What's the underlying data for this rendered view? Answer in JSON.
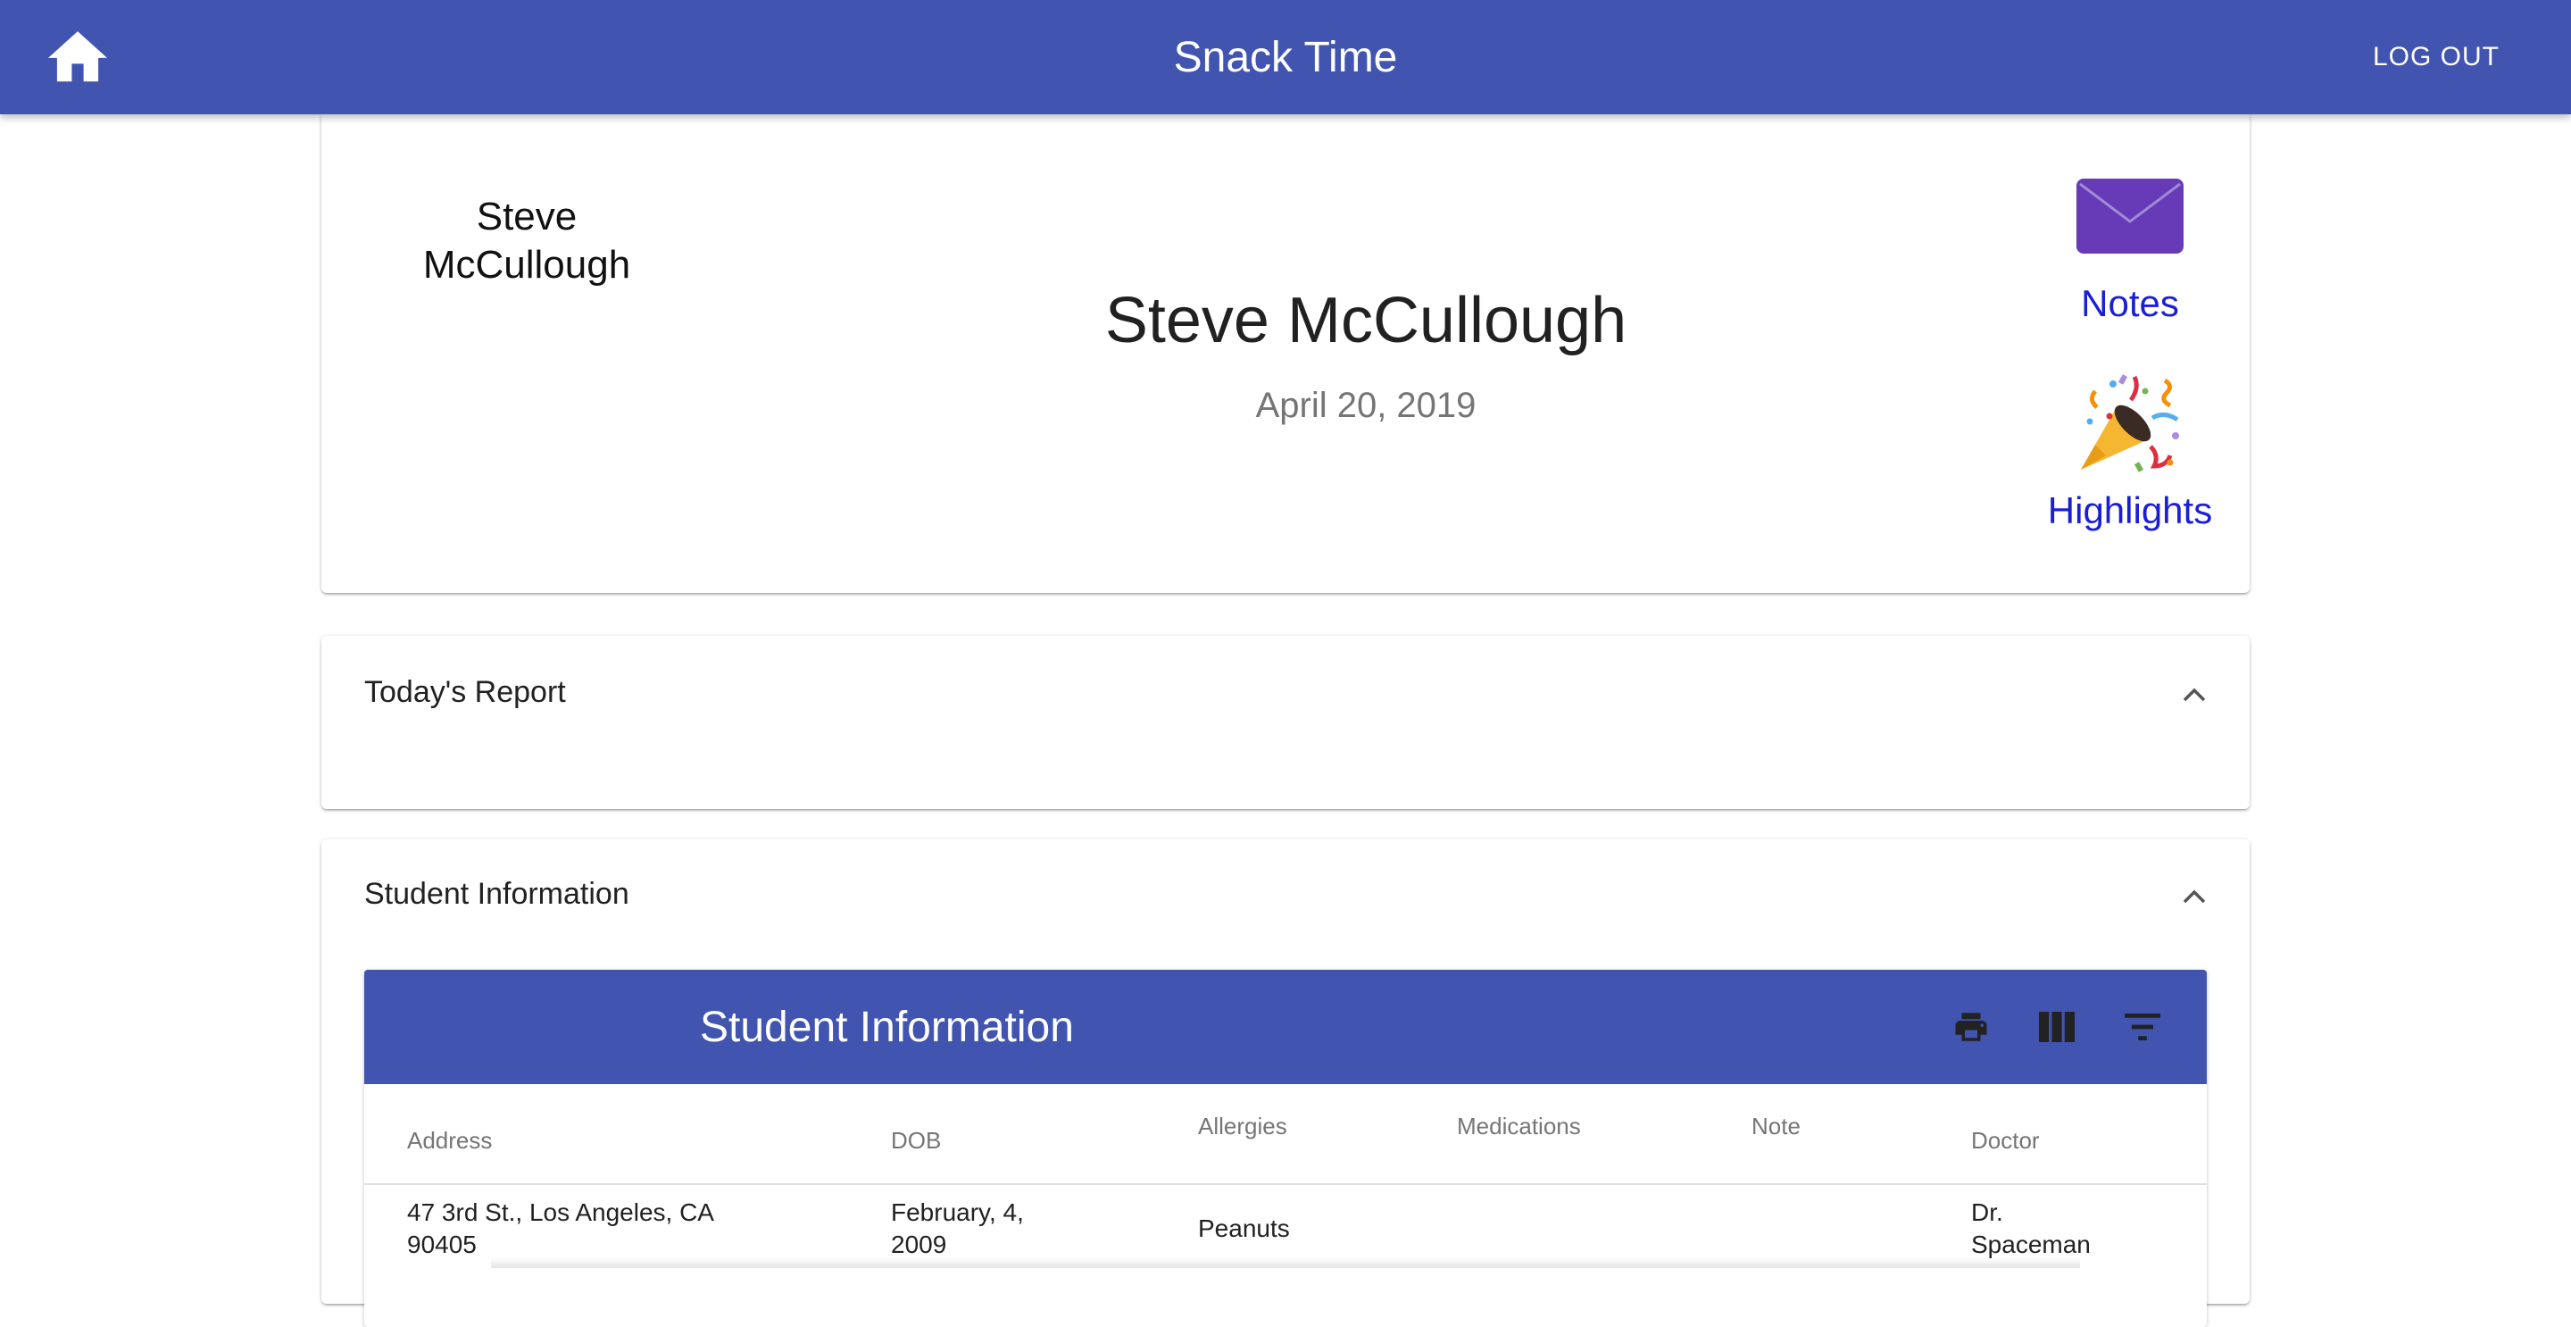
{
  "appbar": {
    "title": "Snack Time",
    "logout_label": "LOG OUT",
    "home_icon": "home-icon",
    "color": "#4155b0"
  },
  "profile": {
    "avatar_alt_text": "Steve McCullough",
    "name": "Steve McCullough",
    "date": "April 20, 2019",
    "notes_label": "Notes",
    "notes_icon": "envelope-icon",
    "highlights_label": "Highlights",
    "highlights_icon": "party-popper-icon",
    "link_color": "#1a1fd6"
  },
  "report_panel": {
    "title": "Today's Report",
    "expanded": true
  },
  "info_panel": {
    "title": "Student Information",
    "expanded": true,
    "table": {
      "title": "Student Information",
      "toolbar_icons": [
        "print-icon",
        "view-column-icon",
        "filter-icon"
      ],
      "columns": [
        "Address",
        "DOB",
        "Allergies",
        "Medications",
        "Note",
        "Doctor"
      ],
      "rows": [
        {
          "address": "47 3rd St., Los Angeles, CA 90405",
          "dob": "February, 4, 2009",
          "allergies": "Peanuts",
          "medications": "",
          "note": "",
          "doctor": "Dr. Spaceman"
        }
      ]
    }
  }
}
